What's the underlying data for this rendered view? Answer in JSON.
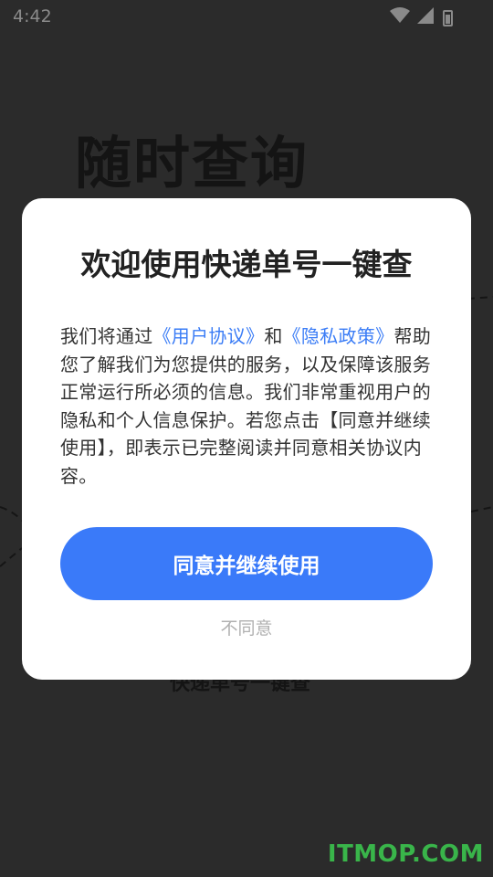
{
  "status_bar": {
    "time": "4:42",
    "icons": [
      "wifi-icon",
      "signal-icon",
      "battery-icon"
    ]
  },
  "background": {
    "title": "随时查询",
    "subtitle": "快递单号一键查"
  },
  "dialog": {
    "title": "欢迎使用快递单号一键查",
    "body": {
      "text_before": "我们将通过",
      "user_agreement_link": "《用户协议》",
      "and": "和",
      "privacy_policy_link": "《隐私政策》",
      "text_after": "帮助您了解我们为您提供的服务，以及保障该服务正常运行所必须的信息。我们非常重视用户的隐私和个人信息保护。若您点击【同意并继续使用】，即表示已完整阅读并同意相关协议内容。"
    },
    "agree_button": "同意并继续使用",
    "disagree_button": "不同意"
  },
  "watermark": "ITMOP.COM",
  "colors": {
    "accent": "#3a7af9",
    "link": "#3a7cf6",
    "overlay": "#2b2b2b",
    "watermark": "#39b54a"
  }
}
